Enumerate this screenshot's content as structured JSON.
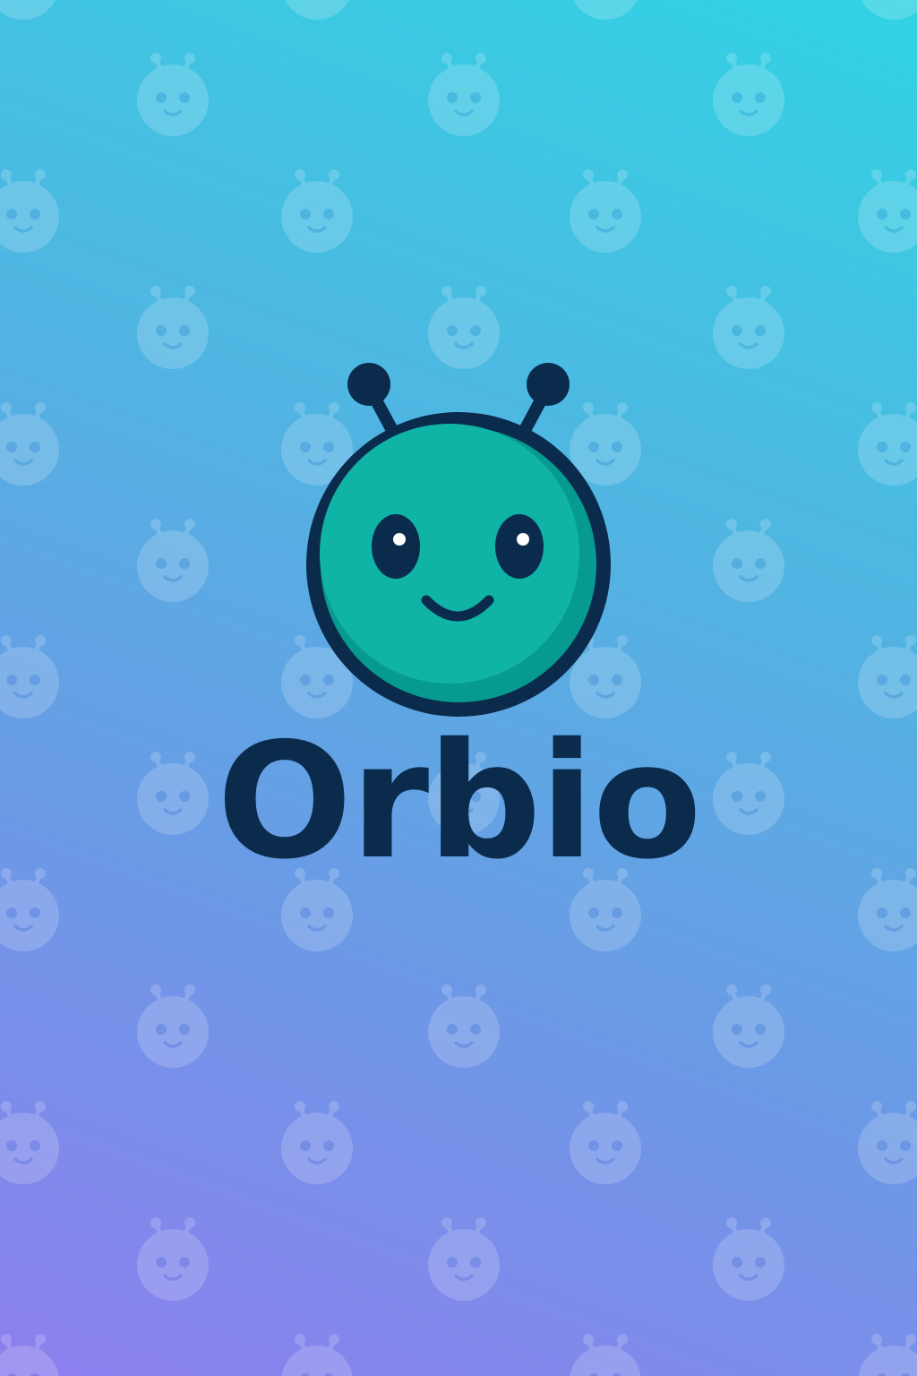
{
  "app": {
    "brand_name": "Orbio"
  },
  "icons": {
    "logo": "alien-mascot-icon",
    "pattern": "alien-face-pattern-icon"
  },
  "colors": {
    "gradient_top": "#31d3e4",
    "gradient_bottom": "#8d7fee",
    "mascot_fill": "#0fb4a6",
    "mascot_shadow": "#079a90",
    "outline": "#0b2b4d",
    "wordmark": "#0b2b4d"
  }
}
